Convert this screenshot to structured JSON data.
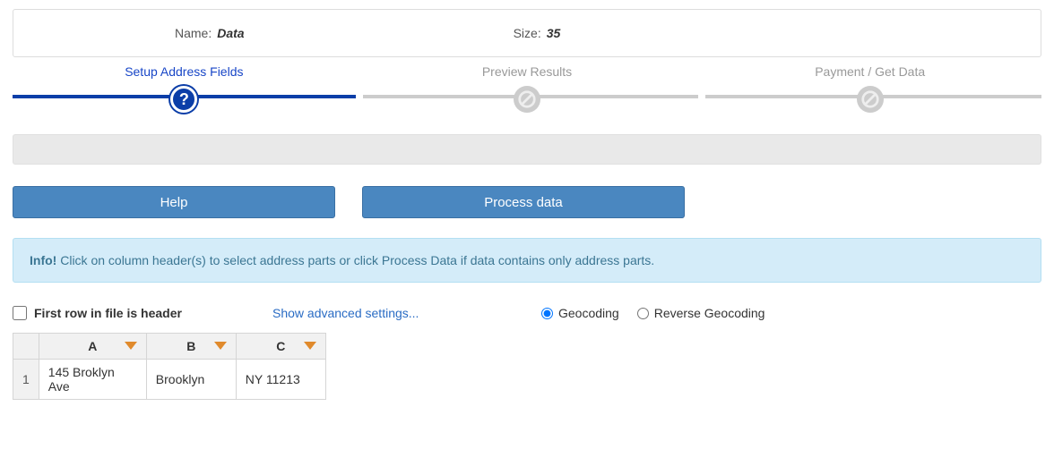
{
  "header": {
    "name_label": "Name:",
    "name_value": "Data",
    "size_label": "Size:",
    "size_value": "35"
  },
  "wizard": {
    "steps": [
      {
        "label": "Setup Address Fields",
        "active": true
      },
      {
        "label": "Preview Results",
        "active": false
      },
      {
        "label": "Payment / Get Data",
        "active": false
      }
    ]
  },
  "buttons": {
    "help": "Help",
    "process": "Process data"
  },
  "info_alert": {
    "bold": "Info!",
    "text": "Click on column header(s) to select address parts or click Process Data if data contains only address parts."
  },
  "controls": {
    "first_row_header_label": "First row in file is header",
    "first_row_header_checked": false,
    "advanced_link": "Show advanced settings...",
    "mode_options": [
      {
        "label": "Geocoding",
        "value": "geo",
        "selected": true
      },
      {
        "label": "Reverse Geocoding",
        "value": "rev",
        "selected": false
      }
    ]
  },
  "grid": {
    "columns": [
      "A",
      "B",
      "C"
    ],
    "rows": [
      {
        "num": "1",
        "cells": [
          "145 Broklyn Ave",
          "Brooklyn",
          "NY 11213"
        ]
      }
    ]
  }
}
